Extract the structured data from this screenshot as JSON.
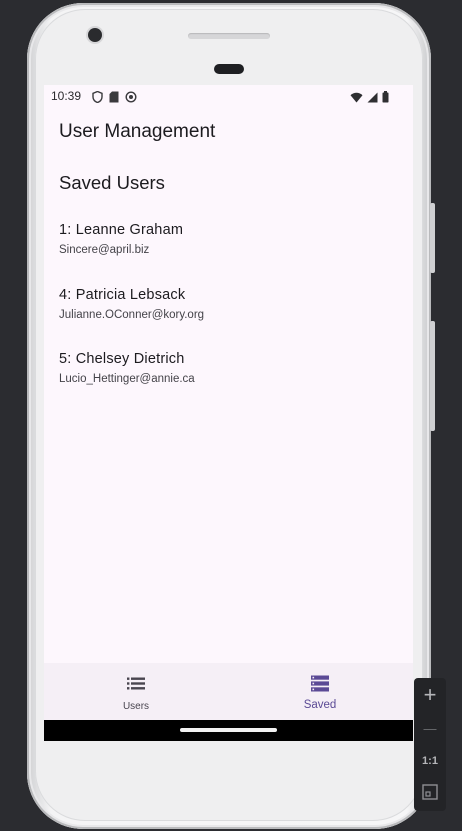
{
  "status_bar": {
    "time": "10:39"
  },
  "app": {
    "title": "User Management",
    "section_title": "Saved Users"
  },
  "saved_users": [
    {
      "name": "1: Leanne Graham",
      "email": "Sincere@april.biz"
    },
    {
      "name": "4: Patricia Lebsack",
      "email": "Julianne.OConner@kory.org"
    },
    {
      "name": "5: Chelsey Dietrich",
      "email": "Lucio_Hettinger@annie.ca"
    }
  ],
  "bottom_nav": {
    "items": [
      {
        "label": "Users",
        "icon": "list-icon",
        "active": false
      },
      {
        "label": "Saved",
        "icon": "storage-icon",
        "active": true
      }
    ]
  },
  "emulator_controls": {
    "zoom_in": "+",
    "zoom_out": "—",
    "actual_size": "1:1"
  },
  "colors": {
    "screen_background": "#fdf7fd",
    "nav_background": "#f5eff6",
    "active_accent": "#5b4a95",
    "inactive_text": "#49454f"
  }
}
